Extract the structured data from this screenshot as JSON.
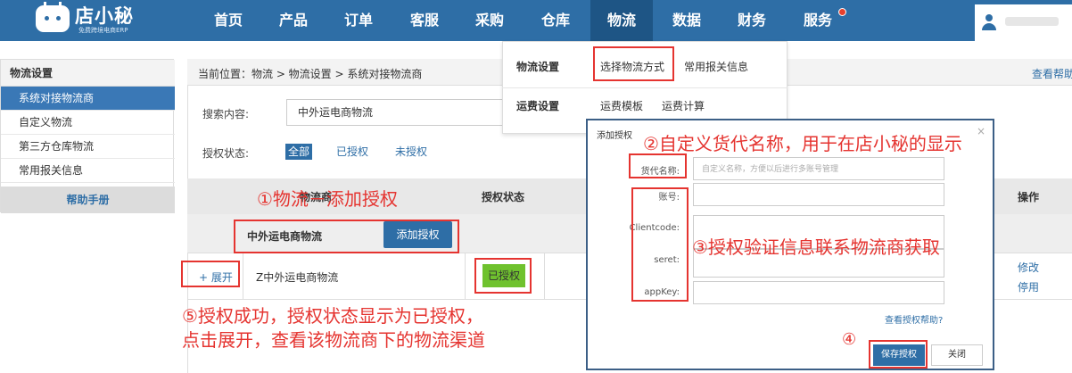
{
  "app": {
    "name": "店小秘",
    "tagline": "免费跨境电商ERP"
  },
  "nav": {
    "items": [
      "首页",
      "产品",
      "订单",
      "客服",
      "采购",
      "仓库",
      "物流",
      "数据",
      "财务",
      "服务"
    ],
    "active": "物流"
  },
  "sidebar": {
    "title": "物流设置",
    "items": [
      "系统对接物流商",
      "自定义物流",
      "第三方仓库物流",
      "常用报关信息"
    ],
    "help": "帮助手册"
  },
  "breadcrumb": "当前位置：物流 > 物流设置 > 系统对接物流商",
  "help_link": "查看帮助",
  "search": {
    "label": "搜索内容:",
    "value": "中外运电商物流"
  },
  "filter": {
    "label": "授权状态:",
    "options": [
      "全部",
      "已授权",
      "未授权"
    ],
    "active": "全部"
  },
  "table": {
    "headers": [
      "物流商",
      "授权状态",
      "操作"
    ],
    "group_name": "中外运电商物流",
    "add_button": "添加授权",
    "row": {
      "expand": "+ 展开",
      "name": "Z中外运电商物流",
      "status": "已授权",
      "actions": [
        "修改",
        "停用"
      ]
    }
  },
  "dropdown": {
    "sections": [
      {
        "title": "物流设置",
        "links": [
          "选择物流方式",
          "常用报关信息"
        ]
      },
      {
        "title": "运费设置",
        "links": [
          "运费模板",
          "运费计算"
        ]
      }
    ]
  },
  "modal": {
    "title": "添加授权",
    "close": "×",
    "fields": [
      {
        "label": "货代名称:",
        "placeholder": "自定义名称，方便以后进行多账号管理"
      },
      {
        "label": "账号:"
      },
      {
        "label": "Clientcode:"
      },
      {
        "label": "seret:"
      },
      {
        "label": "appKey:"
      }
    ],
    "help_link": "查看授权帮助?",
    "save": "保存授权",
    "cancel": "关闭"
  },
  "annotations": {
    "a1": "①物流－添加授权",
    "a2": "②自定义货代名称，用于在店小秘的显示",
    "a3": "③授权验证信息联系物流商获取",
    "a4": "④",
    "a5_line1": "⑤授权成功，授权状态显示为已授权，",
    "a5_line2": "点击展开，查看该物流商下的物流渠道"
  },
  "colors": {
    "nav_bg": "#2e6ea6",
    "annotation": "#e53430",
    "authorized": "#6fc22e"
  }
}
